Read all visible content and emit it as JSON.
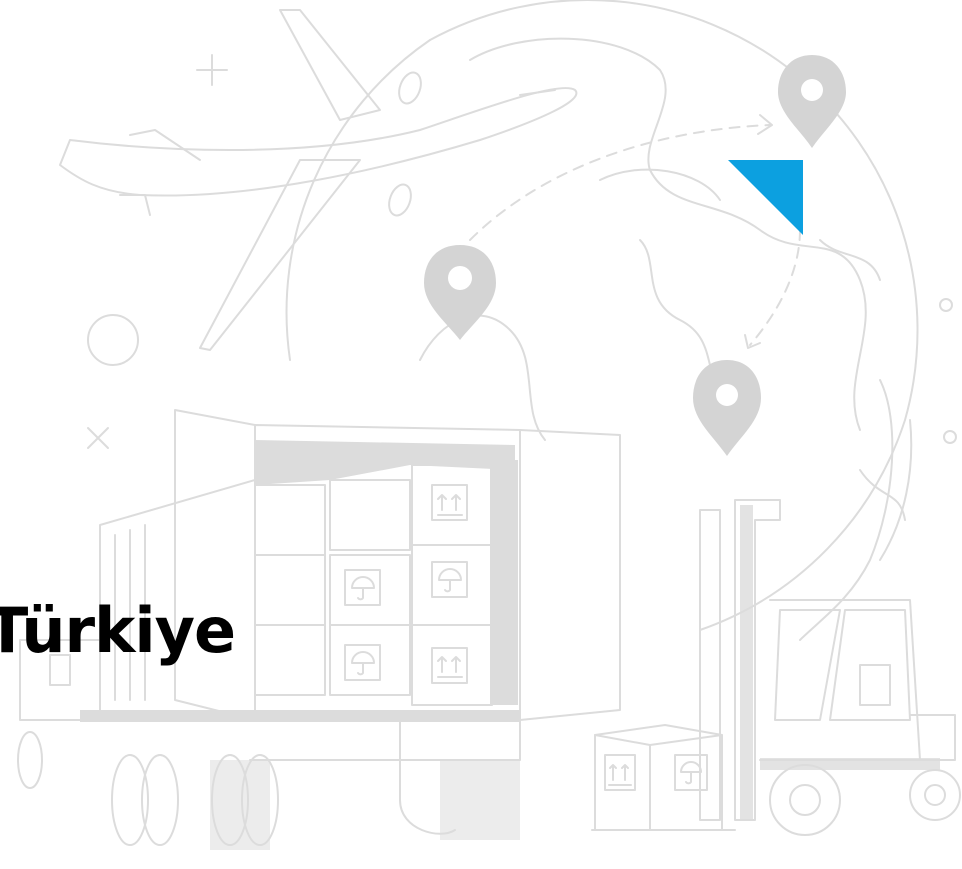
{
  "heading": {
    "text": "Türkiye"
  },
  "colors": {
    "line_art": "#d9d9d9",
    "line_art_dark": "#cfcfcf",
    "accent": "#0ca0e0",
    "background": "#ffffff",
    "text": "#000000"
  },
  "illustration": {
    "icons": [
      "airplane-icon",
      "globe-icon",
      "location-pin-icon",
      "truck-icon",
      "package-box-icon",
      "forklift-icon",
      "fragile-umbrella-icon",
      "this-side-up-icon"
    ]
  }
}
